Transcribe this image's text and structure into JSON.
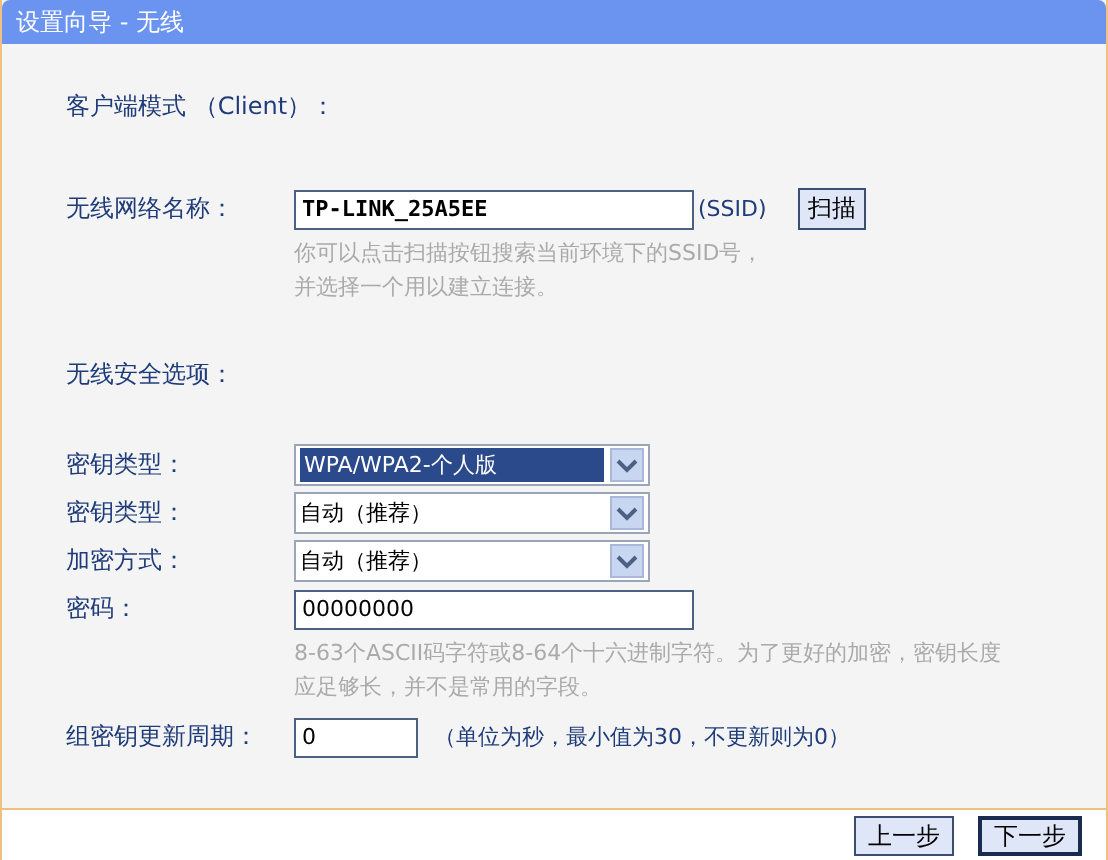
{
  "window": {
    "title": "设置向导 - 无线"
  },
  "mode_label": "客户端模式 （Client）：",
  "ssid": {
    "label": "无线网络名称：",
    "value": "TP-LINK_25A5EE",
    "suffix": "(SSID)",
    "button": "扫描",
    "hint": [
      "你可以点击扫描按钮搜索当前环境下的SSID号，",
      "并选择一个用以建立连接。"
    ]
  },
  "security_heading": "无线安全选项：",
  "fields": [
    {
      "kind": "select",
      "label": "密钥类型：",
      "value": "WPA/WPA2-个人版",
      "highlighted": true
    },
    {
      "kind": "select",
      "label": "密钥类型：",
      "value": "自动（推荐）",
      "highlighted": false
    },
    {
      "kind": "select",
      "label": "加密方式：",
      "value": "自动（推荐）",
      "highlighted": false
    },
    {
      "kind": "text",
      "label": "密码：",
      "value": "00000000",
      "hint": [
        "8-63个ASCII码字符或8-64个十六进制字符。为了更好的加密，密钥长度",
        "应足够长，并不是常用的字段。"
      ]
    },
    {
      "kind": "short",
      "label": "组密钥更新周期：",
      "value": "0",
      "note": "（单位为秒，最小值为30，不更新则为0）"
    }
  ],
  "buttons": [
    {
      "label": "上一步",
      "selected": false
    },
    {
      "label": "下一步",
      "selected": true
    }
  ]
}
